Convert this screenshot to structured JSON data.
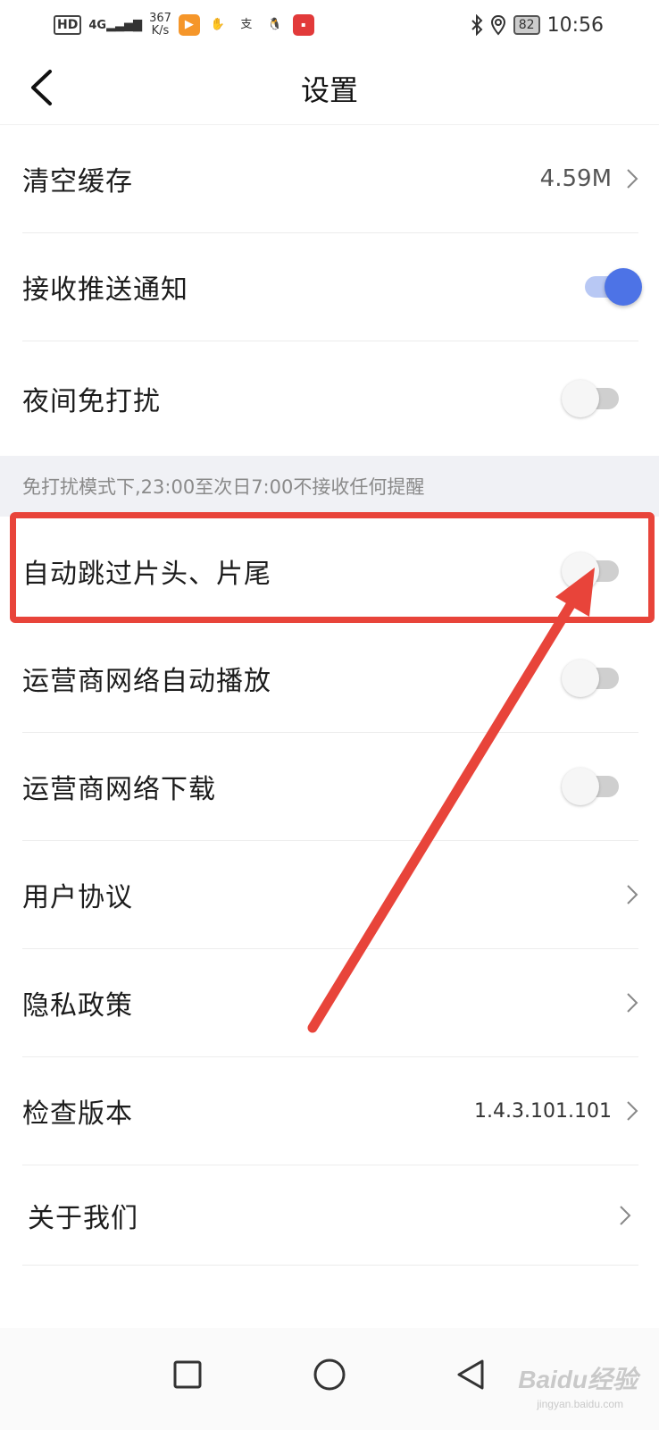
{
  "status_bar": {
    "hd": "HD",
    "signal": "4G",
    "speed_value": "367",
    "speed_unit": "K/s",
    "battery": "82",
    "time": "10:56"
  },
  "header": {
    "title": "设置"
  },
  "settings": {
    "clear_cache": {
      "label": "清空缓存",
      "value": "4.59M"
    },
    "push_notifications": {
      "label": "接收推送通知",
      "enabled": true
    },
    "night_dnd": {
      "label": "夜间免打扰",
      "enabled": false
    },
    "dnd_note": "免打扰模式下,23:00至次日7:00不接收任何提醒",
    "skip_intro_outro": {
      "label": "自动跳过片头、片尾",
      "enabled": false
    },
    "carrier_autoplay": {
      "label": "运营商网络自动播放",
      "enabled": false
    },
    "carrier_download": {
      "label": "运营商网络下载",
      "enabled": false
    },
    "user_agreement": {
      "label": "用户协议"
    },
    "privacy_policy": {
      "label": "隐私政策"
    },
    "check_version": {
      "label": "检查版本",
      "value": "1.4.3.101.101"
    },
    "about_us": {
      "label": "关于我们"
    }
  },
  "watermark": {
    "brand": "Baidu经验",
    "url": "jingyan.baidu.com"
  },
  "colors": {
    "accent": "#4d73e6",
    "highlight": "#e8443a"
  }
}
